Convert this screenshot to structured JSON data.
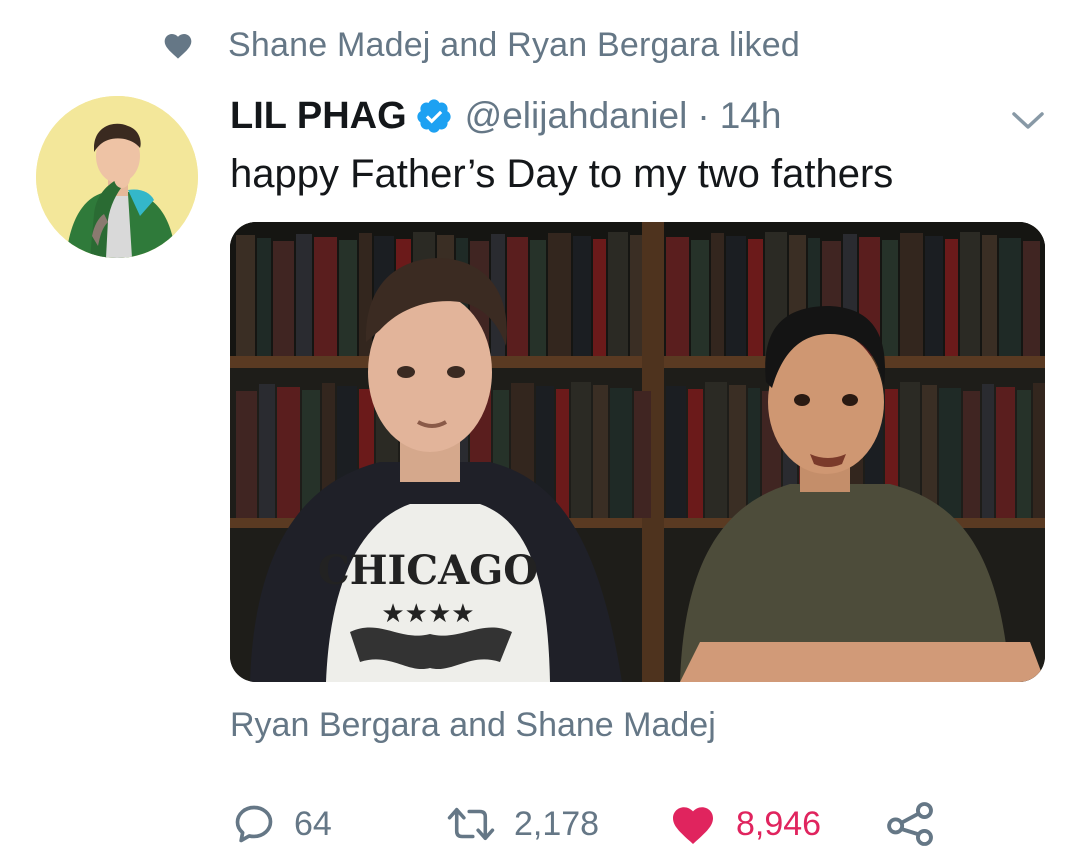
{
  "social_context": {
    "text": "Shane Madej and Ryan Bergara liked",
    "icon": "heart-icon"
  },
  "tweet": {
    "display_name": "LIL PHAG",
    "verified": true,
    "handle": "@elijahdaniel",
    "separator": "·",
    "time": "14h",
    "text": "happy Father’s Day to my two fathers",
    "media_caption": "Ryan Bergara and Shane Madej"
  },
  "actions": {
    "reply": {
      "icon": "reply-icon",
      "count": "64"
    },
    "retweet": {
      "icon": "retweet-icon",
      "count": "2,178"
    },
    "like": {
      "icon": "heart-filled-icon",
      "count": "8,946",
      "liked": true
    },
    "share": {
      "icon": "share-icon"
    }
  },
  "media_shirt_text": "CHICAGO",
  "colors": {
    "secondary_text": "#657786",
    "primary_text": "#14171a",
    "like": "#e0245e",
    "verified": "#1da1f2",
    "avatar_bg": "#f3e79a"
  }
}
